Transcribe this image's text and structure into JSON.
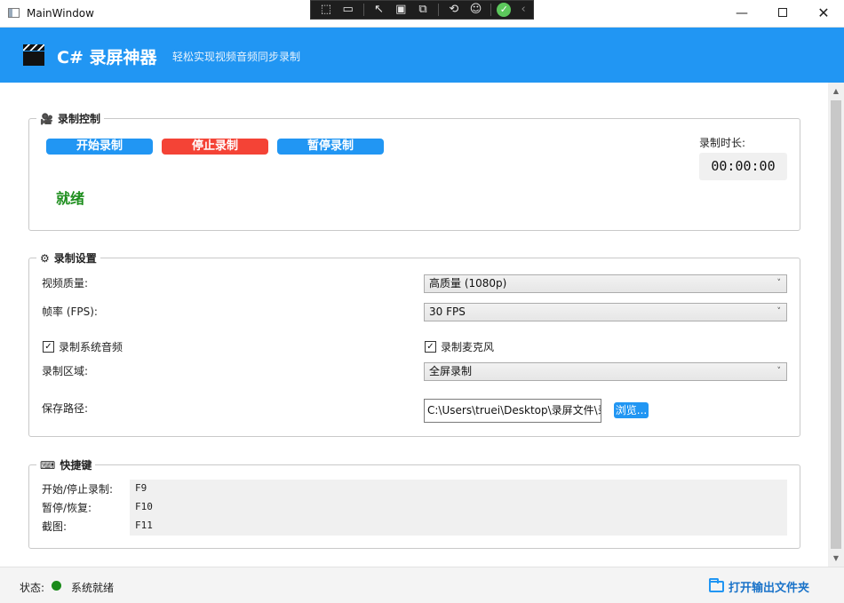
{
  "window": {
    "title": "MainWindow",
    "min_glyph": "—",
    "close_glyph": "✕"
  },
  "devtools": {
    "icons": [
      "select-element-icon",
      "video-icon",
      "pointer-icon",
      "rect-select-icon",
      "display-layout-icon",
      "hot-reload-icon",
      "accessibility-icon",
      "check-icon",
      "collapse-icon"
    ],
    "glyphs": {
      "select": "⬚",
      "video": "▭",
      "pointer": "↖",
      "rect": "▣",
      "layout": "⧉",
      "reload": "⟲",
      "a11y": "☺",
      "check": "✓",
      "collapse": "‹"
    }
  },
  "header": {
    "title": "C# 录屏神器",
    "tagline": "轻松实现视频音频同步录制",
    "accent_color": "#2196f3"
  },
  "control_group": {
    "legend": "录制控制",
    "legend_icon": "camera-icon",
    "legend_glyph": "🎥",
    "start_label": "开始录制",
    "stop_label": "停止录制",
    "pause_label": "暂停录制",
    "status_text": "就绪",
    "duration_label": "录制时长:",
    "duration_value": "00:00:00"
  },
  "settings_group": {
    "legend": "录制设置",
    "legend_icon": "gear-icon",
    "legend_glyph": "⚙",
    "video_quality_label": "视频质量:",
    "video_quality_value": "高质量 (1080p)",
    "fps_label": "帧率 (FPS):",
    "fps_value": "30 FPS",
    "system_audio_label": "录制系统音频",
    "system_audio_checked": true,
    "microphone_label": "录制麦克风",
    "microphone_checked": true,
    "region_label": "录制区域:",
    "region_value": "全屏录制",
    "save_path_label": "保存路径:",
    "save_path_value": "C:\\Users\\truei\\Desktop\\录屏文件\\录",
    "browse_label": "浏览...",
    "check_glyph": "✓",
    "chevron_glyph": "˅"
  },
  "hotkeys_group": {
    "legend": "快捷键",
    "legend_icon": "keyboard-icon",
    "legend_glyph": "⌨",
    "rows": [
      {
        "label": "开始/停止录制:",
        "key": "F9"
      },
      {
        "label": "暂停/恢复:",
        "key": "F10"
      },
      {
        "label": "截图:",
        "key": "F11"
      }
    ]
  },
  "statusbar": {
    "label": "状态:",
    "text": "系统就绪",
    "status_color": "#1a8a1a",
    "open_folder_label": "打开输出文件夹"
  },
  "scrollbar": {
    "up_glyph": "▲",
    "down_glyph": "▼"
  }
}
